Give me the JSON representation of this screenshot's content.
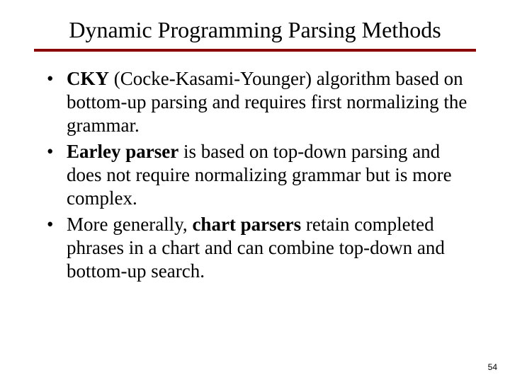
{
  "title": "Dynamic Programming Parsing Methods",
  "bullets": [
    {
      "bold": "CKY",
      "rest": " (Cocke-Kasami-Younger) algorithm based on bottom-up parsing and requires first normalizing the grammar."
    },
    {
      "bold": "Earley parser",
      "rest": " is based on top-down parsing and does not require normalizing grammar but is more complex."
    },
    {
      "pre": "More generally, ",
      "bold": "chart parsers",
      "rest": " retain completed phrases in a chart and can combine top-down and bottom-up search."
    }
  ],
  "page_number": "54"
}
